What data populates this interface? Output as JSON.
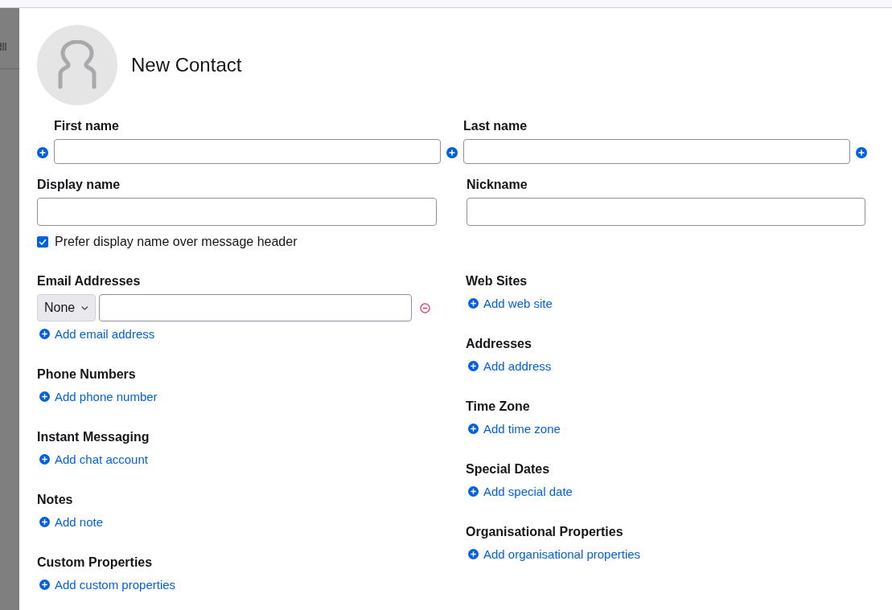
{
  "header": {
    "title": "New Contact"
  },
  "name_row": [
    {
      "label": "First name"
    },
    {
      "label": "Last name"
    }
  ],
  "display_row": [
    {
      "label": "Display name"
    },
    {
      "label": "Nickname"
    }
  ],
  "prefer_display_name": {
    "label": "Prefer display name over message header",
    "checked": true
  },
  "left_sections": [
    {
      "kind": "email",
      "heading": "Email Addresses",
      "entries": [
        {
          "type": "None"
        }
      ],
      "add_label": "Add email address"
    },
    {
      "kind": "plain",
      "heading": "Phone Numbers",
      "add_label": "Add phone number"
    },
    {
      "kind": "plain",
      "heading": "Instant Messaging",
      "add_label": "Add chat account"
    },
    {
      "kind": "plain",
      "heading": "Notes",
      "add_label": "Add note"
    },
    {
      "kind": "plain",
      "heading": "Custom Properties",
      "add_label": "Add custom properties"
    }
  ],
  "right_sections": [
    {
      "kind": "plain",
      "heading": "Web Sites",
      "add_label": "Add web site"
    },
    {
      "kind": "plain",
      "heading": "Addresses",
      "add_label": "Add address"
    },
    {
      "kind": "plain",
      "heading": "Time Zone",
      "add_label": "Add time zone"
    },
    {
      "kind": "plain",
      "heading": "Special Dates",
      "add_label": "Add special date"
    },
    {
      "kind": "plain",
      "heading": "Organisational Properties",
      "add_label": "Add organisational properties"
    }
  ]
}
